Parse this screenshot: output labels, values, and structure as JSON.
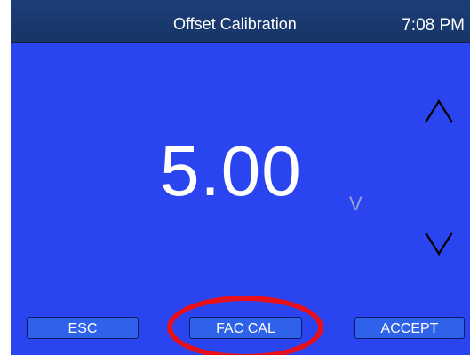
{
  "titlebar": {
    "title": "Offset Calibration",
    "clock": "7:08 PM"
  },
  "display": {
    "value": "5.00",
    "unit": "V"
  },
  "controls": {
    "increase_icon": "chevron-up-icon",
    "decrease_icon": "chevron-down-icon"
  },
  "softkeys": {
    "esc_label": "ESC",
    "fac_cal_label": "FAC CAL",
    "accept_label": "ACCEPT"
  },
  "annotation": {
    "highlight_color": "#e8101a",
    "highlight_target": "FAC CAL"
  },
  "colors": {
    "screen_bg": "#2a44f0",
    "titlebar_bg": "#1c3e78",
    "button_bg": "#2f62ea"
  }
}
